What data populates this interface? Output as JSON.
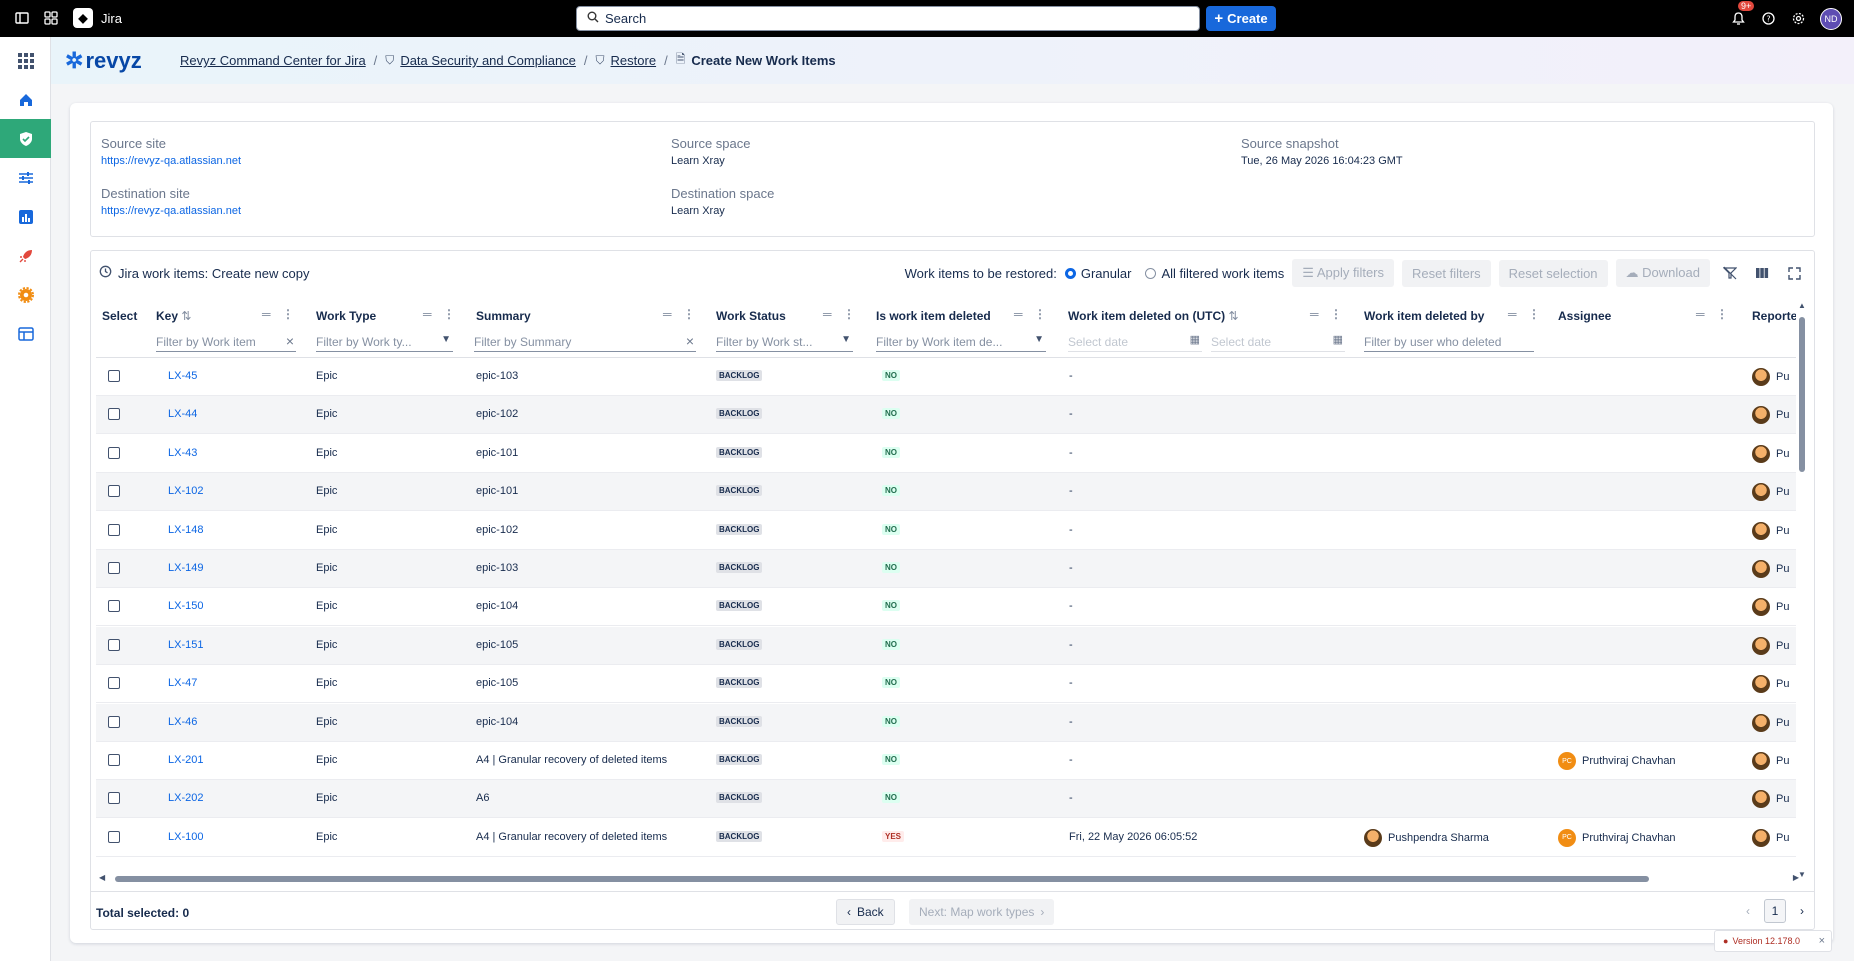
{
  "topbar": {
    "app_name": "Jira",
    "search_placeholder": "Search",
    "create_label": "Create",
    "notif_badge": "9+",
    "user_initials": "ND"
  },
  "breadcrumb": {
    "items": [
      "Revyz Command Center for Jira",
      "Data Security and Compliance",
      "Restore"
    ],
    "current": "Create New Work Items"
  },
  "logo": {
    "text": "revyz"
  },
  "info": {
    "source_site_label": "Source site",
    "source_site": "https://revyz-qa.atlassian.net",
    "source_space_label": "Source space",
    "source_space": "Learn Xray",
    "source_snapshot_label": "Source snapshot",
    "source_snapshot": "Tue, 26 May 2026 16:04:23 GMT",
    "dest_site_label": "Destination site",
    "dest_site": "https://revyz-qa.atlassian.net",
    "dest_space_label": "Destination space",
    "dest_space": "Learn Xray"
  },
  "table_header": {
    "title": "Jira work items: Create new copy",
    "restore_label": "Work items to be restored:",
    "granular": "Granular",
    "all_filtered": "All filtered work items",
    "apply_filters": "Apply filters",
    "reset_filters": "Reset filters",
    "reset_selection": "Reset selection",
    "download": "Download"
  },
  "columns": {
    "select": "Select",
    "key": "Key",
    "work_type": "Work Type",
    "summary": "Summary",
    "work_status": "Work Status",
    "is_deleted": "Is work item deleted",
    "deleted_on": "Work item deleted on (UTC)",
    "deleted_by": "Work item deleted by",
    "assignee": "Assignee",
    "reporter": "Reporte"
  },
  "filters": {
    "key": "Filter by Work item",
    "work_type": "Filter by Work ty...",
    "summary": "Filter by Summary",
    "work_status": "Filter by Work st...",
    "is_deleted": "Filter by Work item de...",
    "date_from": "Select date",
    "date_to": "Select date",
    "deleted_by": "Filter by user who deleted"
  },
  "rows": [
    {
      "key": "LX-45",
      "type": "Epic",
      "summary": "epic-103",
      "status": "BACKLOG",
      "deleted": "NO",
      "deleted_on": "-",
      "deleted_by": "",
      "assignee": "",
      "reporter": "Pu"
    },
    {
      "key": "LX-44",
      "type": "Epic",
      "summary": "epic-102",
      "status": "BACKLOG",
      "deleted": "NO",
      "deleted_on": "-",
      "deleted_by": "",
      "assignee": "",
      "reporter": "Pu"
    },
    {
      "key": "LX-43",
      "type": "Epic",
      "summary": "epic-101",
      "status": "BACKLOG",
      "deleted": "NO",
      "deleted_on": "-",
      "deleted_by": "",
      "assignee": "",
      "reporter": "Pu"
    },
    {
      "key": "LX-102",
      "type": "Epic",
      "summary": "epic-101",
      "status": "BACKLOG",
      "deleted": "NO",
      "deleted_on": "-",
      "deleted_by": "",
      "assignee": "",
      "reporter": "Pu"
    },
    {
      "key": "LX-148",
      "type": "Epic",
      "summary": "epic-102",
      "status": "BACKLOG",
      "deleted": "NO",
      "deleted_on": "-",
      "deleted_by": "",
      "assignee": "",
      "reporter": "Pu"
    },
    {
      "key": "LX-149",
      "type": "Epic",
      "summary": "epic-103",
      "status": "BACKLOG",
      "deleted": "NO",
      "deleted_on": "-",
      "deleted_by": "",
      "assignee": "",
      "reporter": "Pu"
    },
    {
      "key": "LX-150",
      "type": "Epic",
      "summary": "epic-104",
      "status": "BACKLOG",
      "deleted": "NO",
      "deleted_on": "-",
      "deleted_by": "",
      "assignee": "",
      "reporter": "Pu"
    },
    {
      "key": "LX-151",
      "type": "Epic",
      "summary": "epic-105",
      "status": "BACKLOG",
      "deleted": "NO",
      "deleted_on": "-",
      "deleted_by": "",
      "assignee": "",
      "reporter": "Pu"
    },
    {
      "key": "LX-47",
      "type": "Epic",
      "summary": "epic-105",
      "status": "BACKLOG",
      "deleted": "NO",
      "deleted_on": "-",
      "deleted_by": "",
      "assignee": "",
      "reporter": "Pu"
    },
    {
      "key": "LX-46",
      "type": "Epic",
      "summary": "epic-104",
      "status": "BACKLOG",
      "deleted": "NO",
      "deleted_on": "-",
      "deleted_by": "",
      "assignee": "",
      "reporter": "Pu"
    },
    {
      "key": "LX-201",
      "type": "Epic",
      "summary": "A4 | Granular recovery of deleted items",
      "status": "BACKLOG",
      "deleted": "NO",
      "deleted_on": "-",
      "deleted_by": "",
      "assignee": "Pruthviraj Chavhan",
      "assignee_initials": "PC",
      "reporter": "Pu"
    },
    {
      "key": "LX-202",
      "type": "Epic",
      "summary": "A6",
      "status": "BACKLOG",
      "deleted": "NO",
      "deleted_on": "-",
      "deleted_by": "",
      "assignee": "",
      "reporter": "Pu"
    },
    {
      "key": "LX-100",
      "type": "Epic",
      "summary": "A4 | Granular recovery of deleted items",
      "status": "BACKLOG",
      "deleted": "YES",
      "deleted_on": "Fri, 22 May 2026 06:05:52",
      "deleted_by": "Pushpendra Sharma",
      "assignee": "Pruthviraj Chavhan",
      "assignee_initials": "PC",
      "reporter": "Pu"
    }
  ],
  "footer": {
    "total": "Total selected: 0",
    "back": "Back",
    "next": "Next: Map work types",
    "page": "1"
  },
  "version": "Version 12.178.0"
}
